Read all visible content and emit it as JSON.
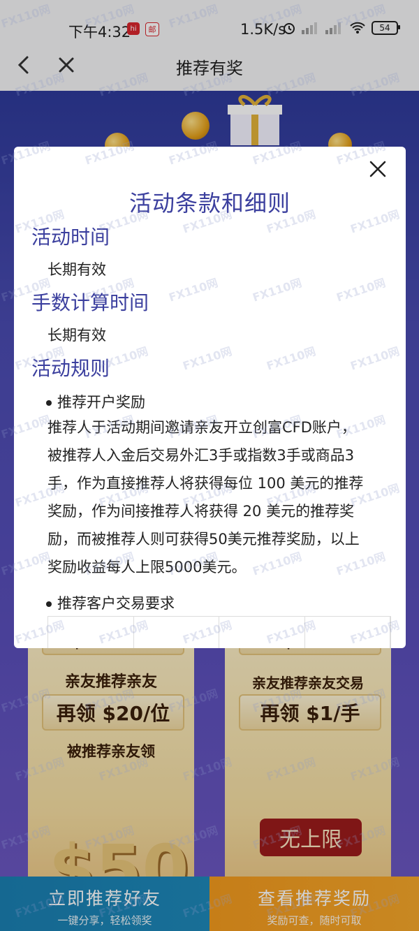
{
  "status": {
    "time": "下午4:32",
    "badge1": "hi",
    "badge2": "邮",
    "net_speed": "1.5K/s",
    "battery": "54"
  },
  "nav": {
    "title": "推荐有奖"
  },
  "modal": {
    "title": "活动条款和细则",
    "sections": [
      {
        "heading": "活动时间",
        "body": "长期有效"
      },
      {
        "heading": "手数计算时间",
        "body": "长期有效"
      },
      {
        "heading": "活动规则"
      }
    ],
    "bullet1": "推荐开户奖励",
    "rule_lines": [
      "推荐人于活动期间邀请亲友开立创富CFD账户，",
      "被推荐人入金后交易外汇3手或指数3手或商品3",
      "手，作为直接推荐人将获得每位 100 美元的推荐",
      "奖励，作为间接推荐人将获得 20 美元的推荐奖",
      "励，而被推荐人则可获得50美元推荐奖励，以上",
      "奖励收益每人上限5000美元。"
    ],
    "bullet2": "推荐客户交易要求"
  },
  "cards": {
    "left": {
      "amount_top": "$100/位",
      "line1": "亲友推荐亲友",
      "amount_mid": "再领 $20/位",
      "line2": "被推荐亲友领",
      "big": "$50"
    },
    "right": {
      "amount_top": "$2/手",
      "line1": "亲友推荐亲友交易",
      "amount_mid": "再领 $1/手",
      "unlimited": "无上限"
    }
  },
  "bottom": {
    "share_main": "立即推荐好友",
    "share_sub": "一键分享，轻松领奖",
    "view_main": "查看推荐奖励",
    "view_sub": "奖励可查，随时可取"
  },
  "watermark": "FX110网"
}
